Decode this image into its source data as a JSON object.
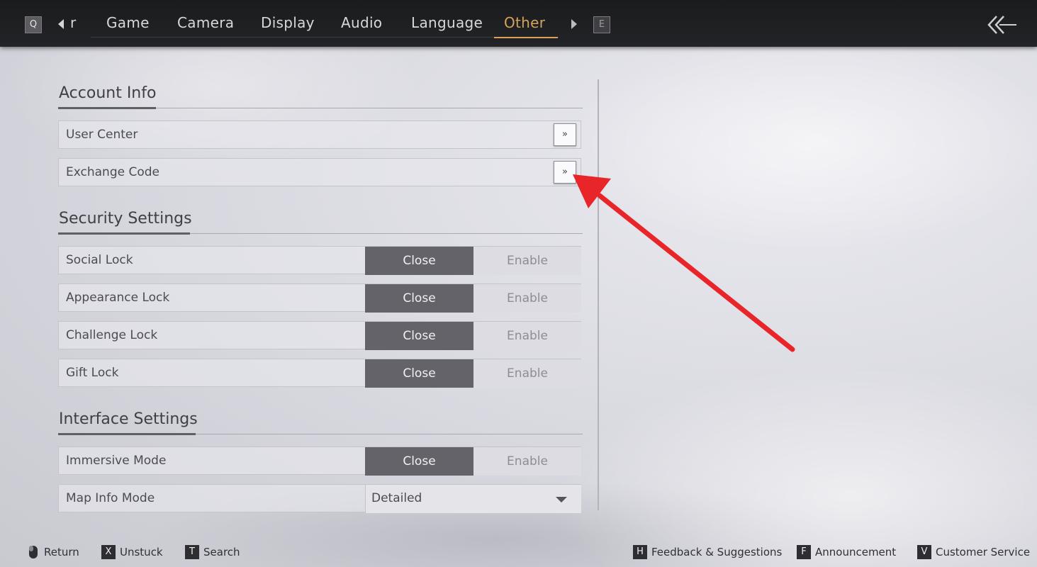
{
  "topbar": {
    "prev_key": "Q",
    "next_key": "E",
    "tabs": [
      {
        "label": "r"
      },
      {
        "label": "Game"
      },
      {
        "label": "Camera"
      },
      {
        "label": "Display"
      },
      {
        "label": "Audio"
      },
      {
        "label": "Language"
      },
      {
        "label": "Other",
        "active": true
      }
    ],
    "back_icon": "back-arrow-icon",
    "active_color": "#d5a35b"
  },
  "sections": {
    "account": {
      "title": "Account Info",
      "rows": [
        {
          "label": "User Center",
          "action": "»"
        },
        {
          "label": "Exchange Code",
          "action": "»"
        }
      ]
    },
    "security": {
      "title": "Security Settings",
      "rows": [
        {
          "label": "Social Lock",
          "option_a": "Close",
          "option_b": "Enable",
          "selected": "Close"
        },
        {
          "label": "Appearance Lock",
          "option_a": "Close",
          "option_b": "Enable",
          "selected": "Close"
        },
        {
          "label": "Challenge Lock",
          "option_a": "Close",
          "option_b": "Enable",
          "selected": "Close"
        },
        {
          "label": "Gift Lock",
          "option_a": "Close",
          "option_b": "Enable",
          "selected": "Close"
        }
      ]
    },
    "interface": {
      "title": "Interface Settings",
      "rows": [
        {
          "label": "Immersive Mode",
          "option_a": "Close",
          "option_b": "Enable",
          "selected": "Close"
        },
        {
          "label": "Map Info Mode",
          "value": "Detailed"
        }
      ]
    }
  },
  "bottombar": {
    "left": [
      {
        "key": "",
        "icon": "mouse-icon",
        "label": "Return"
      },
      {
        "key": "X",
        "label": "Unstuck"
      },
      {
        "key": "T",
        "label": "Search"
      }
    ],
    "right": [
      {
        "key": "H",
        "label": "Feedback & Suggestions"
      },
      {
        "key": "F",
        "label": "Announcement"
      },
      {
        "key": "V",
        "label": "Customer Service"
      }
    ]
  },
  "annotation": {
    "color": "#e8262a",
    "icon": "red-pointer-arrow-icon"
  }
}
